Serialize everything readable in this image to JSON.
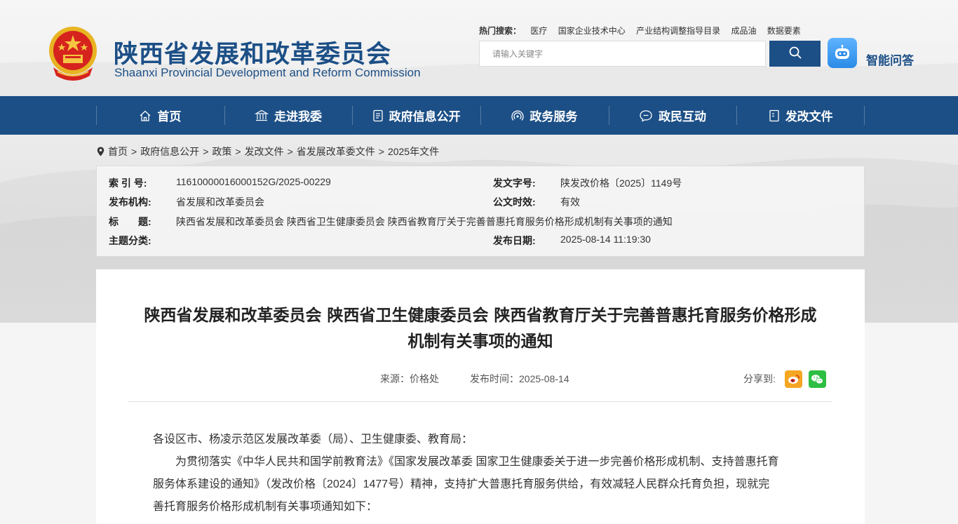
{
  "header": {
    "title": "陕西省发展和改革委员会",
    "subtitle": "Shaanxi Provincial Development and Reform Commission",
    "hot_search_label": "热门搜索：",
    "hot_search_items": [
      "医疗",
      "国家企业技术中心",
      "产业结构调整指导目录",
      "成品油",
      "数据要素"
    ],
    "search_placeholder": "请输入关键字",
    "ai_label": "智能问答"
  },
  "nav": {
    "items": [
      {
        "label": "首页",
        "icon": "home-icon"
      },
      {
        "label": "走进我委",
        "icon": "building-icon"
      },
      {
        "label": "政府信息公开",
        "icon": "document-icon"
      },
      {
        "label": "政务服务",
        "icon": "signal-icon"
      },
      {
        "label": "政民互动",
        "icon": "chat-icon"
      },
      {
        "label": "发改文件",
        "icon": "file-icon"
      }
    ]
  },
  "breadcrumb": {
    "items": [
      "首页",
      "政府信息公开",
      "政策",
      "发改文件",
      "省发展改革委文件",
      "2025年文件"
    ],
    "separator": ">"
  },
  "meta": {
    "index_key": "索 引 号:",
    "index_val": "11610000016000152G/2025-00229",
    "doc_no_key": "发文字号:",
    "doc_no_val": "陕发改价格〔2025〕1149号",
    "publisher_key": "发布机构:",
    "publisher_val": "省发展和改革委员会",
    "validity_key": "公文时效:",
    "validity_val": "有效",
    "title_key": "标　　题:",
    "title_val": "陕西省发展和改革委员会 陕西省卫生健康委员会 陕西省教育厅关于完善普惠托育服务价格形成机制有关事项的通知",
    "category_key": "主题分类:",
    "category_val": "",
    "date_key": "发布日期:",
    "date_val": "2025-08-14 11:19:30"
  },
  "article": {
    "title_line1": "陕西省发展和改革委员会 陕西省卫生健康委员会 陕西省教育厅关于完善普惠托育服务价格形成",
    "title_line2": "机制有关事项的通知",
    "source": "来源：价格处",
    "publish_time": "发布时间：2025-08-14",
    "share_label": "分享到:",
    "greeting": "各设区市、杨凌示范区发展改革委（局）、卫生健康委、教育局：",
    "para1_line1": "为贯彻落实《中华人民共和国学前教育法》《国家发展改革委 国家卫生健康委关于进一步完善价格形成机制、支持普惠托育",
    "para1_line2": "服务体系建设的通知》（发改价格〔2024〕1477号）精神，支持扩大普惠托育服务供给，有效减轻人民群众托育负担，现就完",
    "para1_line3": "善托育服务价格形成机制有关事项通知如下："
  },
  "colors": {
    "brand_blue": "#1c4f86",
    "weibo": "#f5a623",
    "wechat": "#2dbe43"
  }
}
